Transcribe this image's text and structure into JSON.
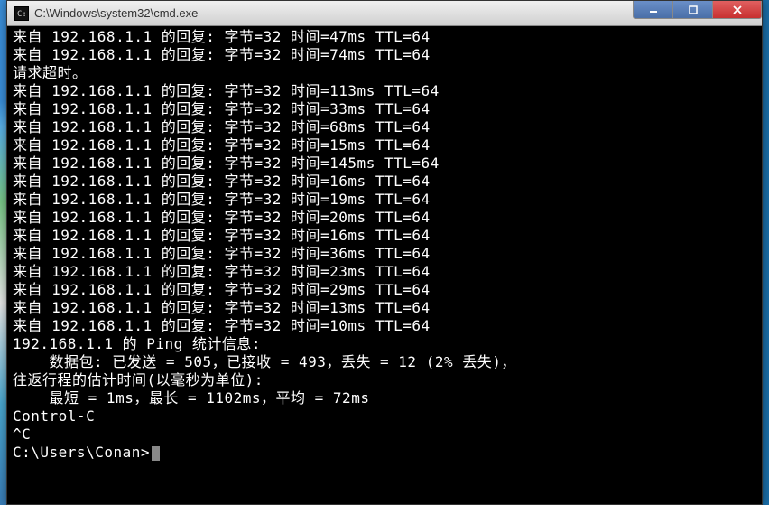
{
  "window": {
    "title": "C:\\Windows\\system32\\cmd.exe"
  },
  "watermark": "",
  "ping": {
    "ip": "192.168.1.1",
    "reply_prefix": "来自 ",
    "reply_mid": " 的回复: 字节=",
    "bytes": "32",
    "time_label": " 时间=",
    "ttl_label": " TTL=",
    "ttl": "64",
    "timeout": "请求超时。",
    "replies": [
      {
        "time": "47ms"
      },
      {
        "time": "74ms"
      },
      {
        "timeout": true
      },
      {
        "time": "113ms"
      },
      {
        "time": "33ms"
      },
      {
        "time": "68ms"
      },
      {
        "time": "15ms"
      },
      {
        "time": "145ms"
      },
      {
        "time": "16ms"
      },
      {
        "time": "19ms"
      },
      {
        "time": "20ms"
      },
      {
        "time": "16ms"
      },
      {
        "time": "36ms"
      },
      {
        "time": "23ms"
      },
      {
        "time": "29ms"
      },
      {
        "time": "13ms"
      },
      {
        "time": "10ms"
      }
    ],
    "stats_header": "192.168.1.1 的 Ping 统计信息:",
    "stats_packets": "    数据包: 已发送 = 505，已接收 = 493，丢失 = 12 (2% 丢失)，",
    "stats_rt_header": "往返行程的估计时间(以毫秒为单位):",
    "stats_rt_values": "    最短 = 1ms，最长 = 1102ms，平均 = 72ms",
    "control_c": "Control-C",
    "caret_c": "^C",
    "prompt": "C:\\Users\\Conan>"
  }
}
